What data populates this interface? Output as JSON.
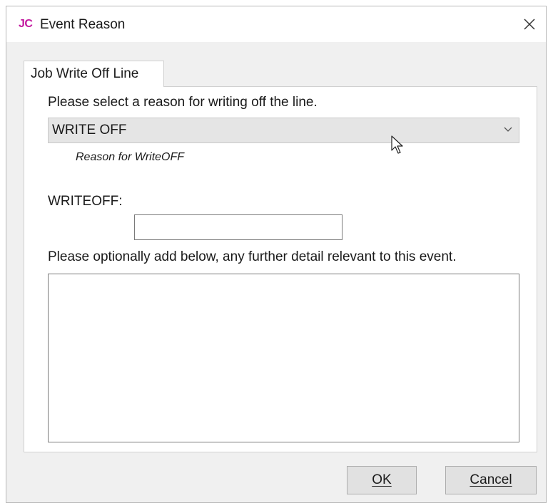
{
  "window": {
    "logo": "JC",
    "title": "Event Reason",
    "close_icon": "close-icon"
  },
  "tab": {
    "label": "Job Write Off Line"
  },
  "form": {
    "reason_prompt": "Please select a reason for writing off the line.",
    "reason_selected": "WRITE OFF",
    "reason_hint": "Reason for WriteOFF",
    "writeoff_label": "WRITEOFF:",
    "writeoff_value": "",
    "detail_prompt": "Please optionally add below, any further detail relevant to this event.",
    "detail_value": ""
  },
  "buttons": {
    "ok": "OK",
    "cancel": "Cancel"
  },
  "icons": {
    "dropdown": "chevron-down-icon",
    "pointer": "mouse-cursor-icon"
  },
  "colors": {
    "logo": "#c2189e",
    "dialog_bg": "#f0f0f0",
    "combo_bg": "#e5e5e5",
    "button_bg": "#e1e1e1"
  }
}
